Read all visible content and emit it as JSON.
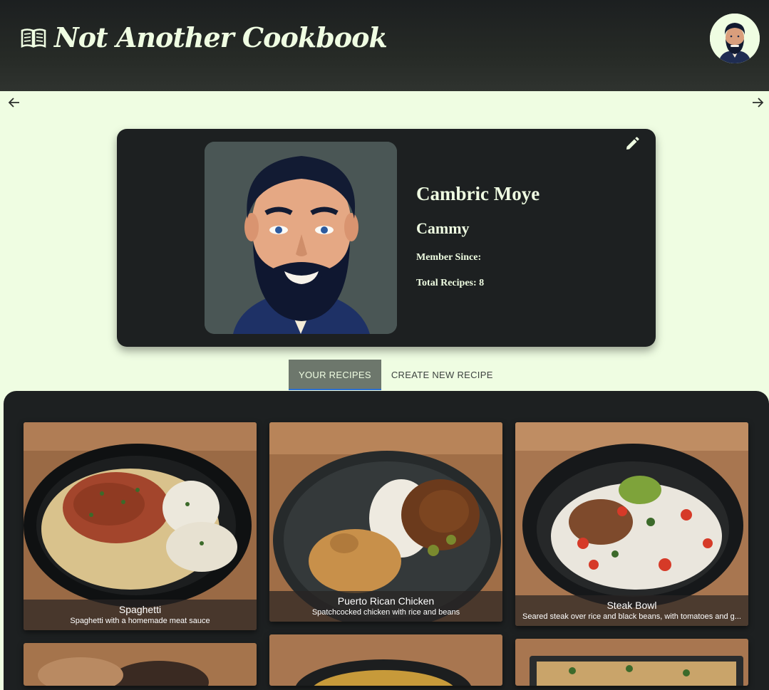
{
  "app": {
    "title": "Not Another Cookbook",
    "brand_icon": "book-open-icon"
  },
  "header": {
    "avatar_icon": "user-avatar"
  },
  "nav": {
    "back_icon": "arrow-left-icon",
    "forward_icon": "arrow-right-icon"
  },
  "profile": {
    "name": "Cambric Moye",
    "nickname": "Cammy",
    "member_since_label": "Member Since:",
    "total_recipes_label": "Total Recipes: 8",
    "edit_icon": "pencil-icon"
  },
  "tabs": [
    {
      "label": "YOUR RECIPES",
      "active": true
    },
    {
      "label": "CREATE NEW RECIPE",
      "active": false
    }
  ],
  "recipes": [
    {
      "title": "Spaghetti",
      "description": "Spaghetti with a homemade meat sauce"
    },
    {
      "title": "Puerto Rican Chicken",
      "description": "Spatchcocked chicken with rice and beans"
    },
    {
      "title": "Steak Bowl",
      "description": "Seared steak over rice and black beans, with tomatoes and g..."
    }
  ],
  "colors": {
    "background": "#effde2",
    "header": "#1c1f20",
    "card": "#1d2021",
    "accent_tab": "#6d776c",
    "tab_indicator": "#2b6fd0"
  }
}
